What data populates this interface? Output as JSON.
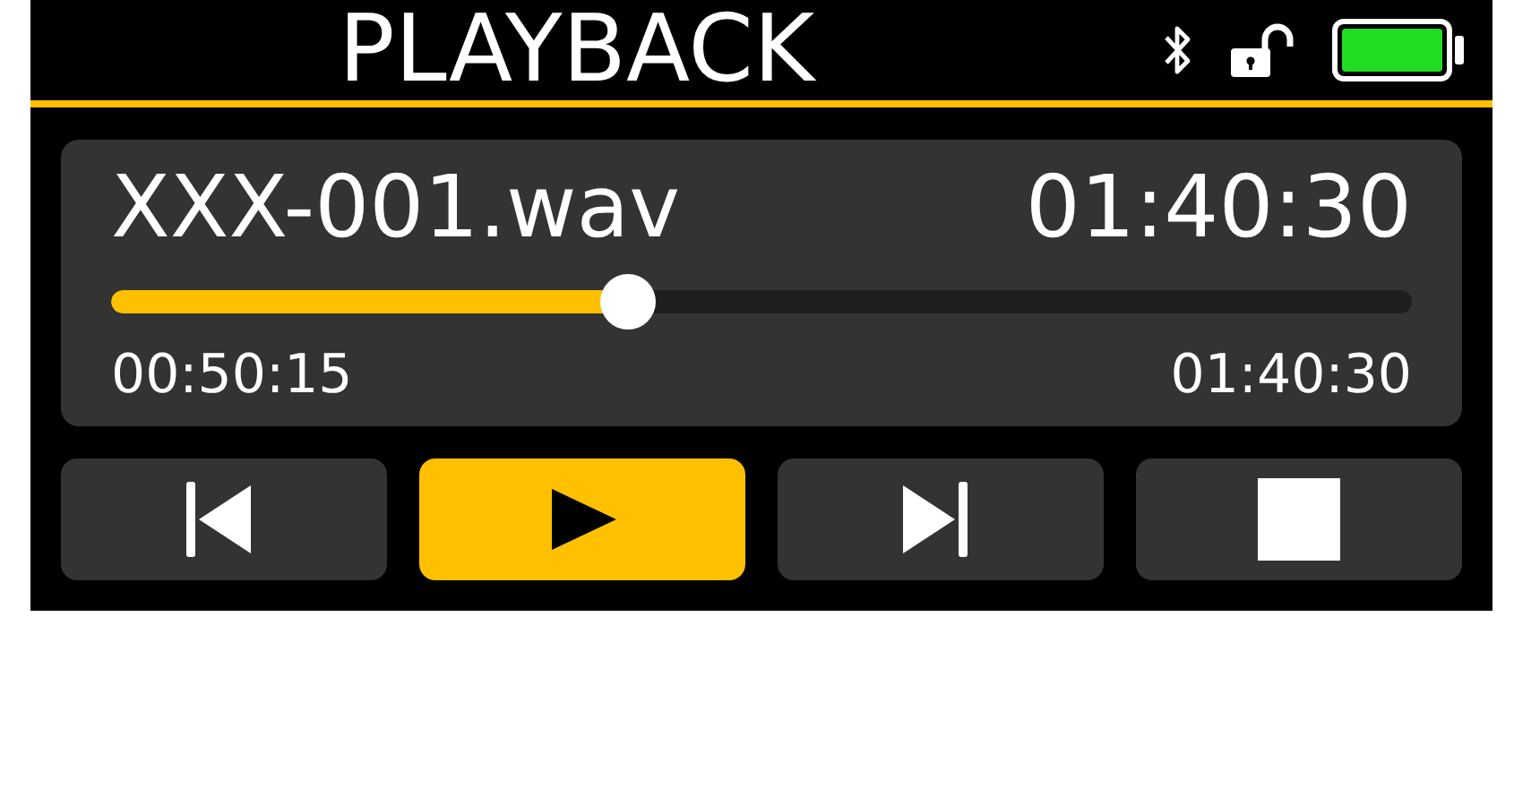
{
  "header": {
    "title": "PLAYBACK",
    "bluetooth": true,
    "locked": false
  },
  "track": {
    "filename": "XXX-001.wav",
    "duration": "01:40:30",
    "level": 0.397,
    "elapsed": "00:50:15",
    "total": "01:40:30"
  },
  "controls": [
    {
      "kind": "previous",
      "selected": false
    },
    {
      "kind": "play",
      "selected": true
    },
    {
      "kind": "next",
      "selected": false
    },
    {
      "kind": "stop",
      "selected": false
    }
  ]
}
